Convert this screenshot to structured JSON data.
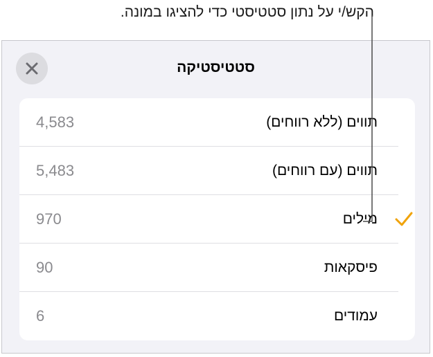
{
  "callout": {
    "text": "הקש/י על נתון סטטיסטי כדי להציגו במונה."
  },
  "dialog": {
    "title": "סטטיסטיקה",
    "close_icon": "close-icon",
    "accent_color": "#f0a30a",
    "rows": [
      {
        "label": "תווים (ללא רווחים)",
        "value": "4,583",
        "selected": false
      },
      {
        "label": "תווים (עם רווחים)",
        "value": "5,483",
        "selected": false
      },
      {
        "label": "מילים",
        "value": "970",
        "selected": true
      },
      {
        "label": "פיסקאות",
        "value": "90",
        "selected": false
      },
      {
        "label": "עמודים",
        "value": "6",
        "selected": false
      }
    ]
  }
}
